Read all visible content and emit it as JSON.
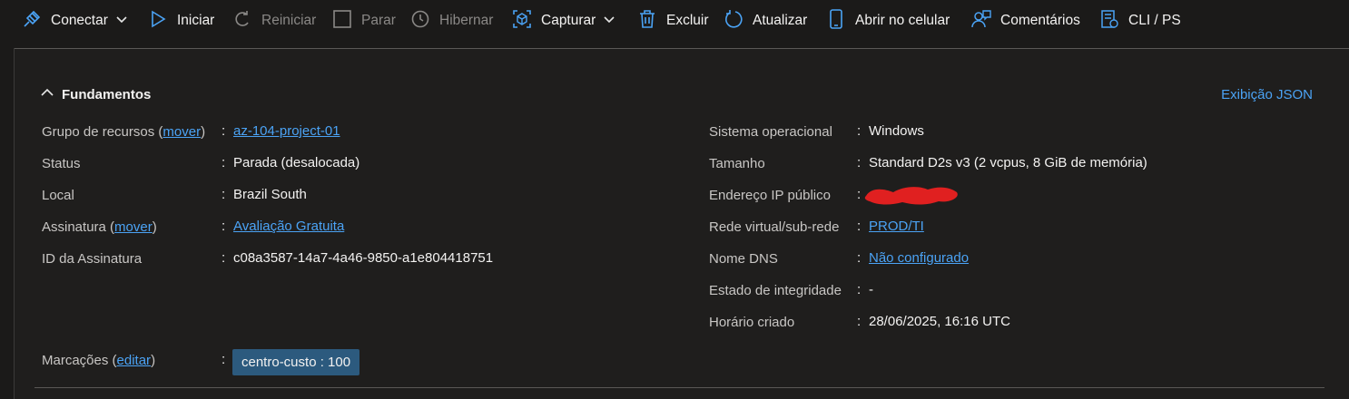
{
  "toolbar": {
    "connect": "Conectar",
    "start": "Iniciar",
    "restart": "Reiniciar",
    "stop": "Parar",
    "hibernate": "Hibernar",
    "capture": "Capturar",
    "delete": "Excluir",
    "refresh": "Atualizar",
    "open_mobile": "Abrir no celular",
    "feedback": "Comentários",
    "cli": "CLI / PS"
  },
  "essentials": {
    "title": "Fundamentos",
    "json_view": "Exibição JSON",
    "left": {
      "resource_group_label": "Grupo de recursos",
      "resource_group_move": "mover",
      "resource_group_value": "az-104-project-01",
      "status_label": "Status",
      "status_value": "Parada (desalocada)",
      "location_label": "Local",
      "location_value": "Brazil South",
      "subscription_label": "Assinatura",
      "subscription_move": "mover",
      "subscription_value": "Avaliação Gratuita",
      "subscription_id_label": "ID da Assinatura",
      "subscription_id_value": "c08a3587-14a7-4a46-9850-a1e804418751"
    },
    "right": {
      "os_label": "Sistema operacional",
      "os_value": "Windows",
      "size_label": "Tamanho",
      "size_value": "Standard D2s v3 (2 vcpus, 8 GiB de memória)",
      "public_ip_label": "Endereço IP público",
      "vnet_label": "Rede virtual/sub-rede",
      "vnet_value": "PROD/TI",
      "dns_label": "Nome DNS",
      "dns_value": "Não configurado",
      "health_label": "Estado de integridade",
      "health_value": "-",
      "created_label": "Horário criado",
      "created_value": "28/06/2025, 16:16 UTC"
    },
    "tags_label": "Marcações",
    "tags_edit": "editar",
    "tag_value": "centro-custo : 100"
  },
  "colors": {
    "accent": "#4ba3f5",
    "tag_bg": "#2c5a7e",
    "background": "#1b1a19",
    "redaction": "#e02020"
  }
}
